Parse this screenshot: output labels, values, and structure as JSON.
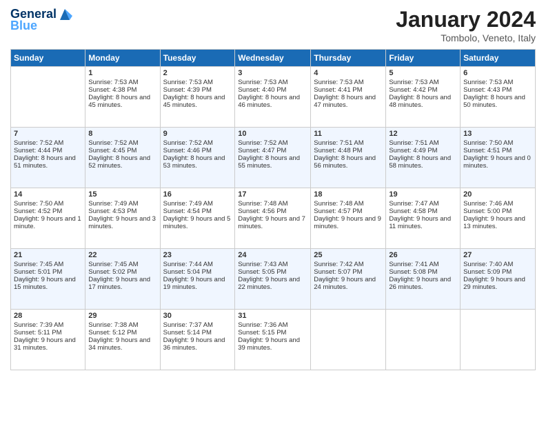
{
  "header": {
    "logo_general": "General",
    "logo_blue": "Blue",
    "title": "January 2024",
    "subtitle": "Tombolo, Veneto, Italy"
  },
  "weekdays": [
    "Sunday",
    "Monday",
    "Tuesday",
    "Wednesday",
    "Thursday",
    "Friday",
    "Saturday"
  ],
  "rows": [
    [
      {
        "day": "",
        "sunrise": "",
        "sunset": "",
        "daylight": "",
        "empty": true
      },
      {
        "day": "1",
        "sunrise": "Sunrise: 7:53 AM",
        "sunset": "Sunset: 4:38 PM",
        "daylight": "Daylight: 8 hours and 45 minutes."
      },
      {
        "day": "2",
        "sunrise": "Sunrise: 7:53 AM",
        "sunset": "Sunset: 4:39 PM",
        "daylight": "Daylight: 8 hours and 45 minutes."
      },
      {
        "day": "3",
        "sunrise": "Sunrise: 7:53 AM",
        "sunset": "Sunset: 4:40 PM",
        "daylight": "Daylight: 8 hours and 46 minutes."
      },
      {
        "day": "4",
        "sunrise": "Sunrise: 7:53 AM",
        "sunset": "Sunset: 4:41 PM",
        "daylight": "Daylight: 8 hours and 47 minutes."
      },
      {
        "day": "5",
        "sunrise": "Sunrise: 7:53 AM",
        "sunset": "Sunset: 4:42 PM",
        "daylight": "Daylight: 8 hours and 48 minutes."
      },
      {
        "day": "6",
        "sunrise": "Sunrise: 7:53 AM",
        "sunset": "Sunset: 4:43 PM",
        "daylight": "Daylight: 8 hours and 50 minutes."
      }
    ],
    [
      {
        "day": "7",
        "sunrise": "Sunrise: 7:52 AM",
        "sunset": "Sunset: 4:44 PM",
        "daylight": "Daylight: 8 hours and 51 minutes."
      },
      {
        "day": "8",
        "sunrise": "Sunrise: 7:52 AM",
        "sunset": "Sunset: 4:45 PM",
        "daylight": "Daylight: 8 hours and 52 minutes."
      },
      {
        "day": "9",
        "sunrise": "Sunrise: 7:52 AM",
        "sunset": "Sunset: 4:46 PM",
        "daylight": "Daylight: 8 hours and 53 minutes."
      },
      {
        "day": "10",
        "sunrise": "Sunrise: 7:52 AM",
        "sunset": "Sunset: 4:47 PM",
        "daylight": "Daylight: 8 hours and 55 minutes."
      },
      {
        "day": "11",
        "sunrise": "Sunrise: 7:51 AM",
        "sunset": "Sunset: 4:48 PM",
        "daylight": "Daylight: 8 hours and 56 minutes."
      },
      {
        "day": "12",
        "sunrise": "Sunrise: 7:51 AM",
        "sunset": "Sunset: 4:49 PM",
        "daylight": "Daylight: 8 hours and 58 minutes."
      },
      {
        "day": "13",
        "sunrise": "Sunrise: 7:50 AM",
        "sunset": "Sunset: 4:51 PM",
        "daylight": "Daylight: 9 hours and 0 minutes."
      }
    ],
    [
      {
        "day": "14",
        "sunrise": "Sunrise: 7:50 AM",
        "sunset": "Sunset: 4:52 PM",
        "daylight": "Daylight: 9 hours and 1 minute."
      },
      {
        "day": "15",
        "sunrise": "Sunrise: 7:49 AM",
        "sunset": "Sunset: 4:53 PM",
        "daylight": "Daylight: 9 hours and 3 minutes."
      },
      {
        "day": "16",
        "sunrise": "Sunrise: 7:49 AM",
        "sunset": "Sunset: 4:54 PM",
        "daylight": "Daylight: 9 hours and 5 minutes."
      },
      {
        "day": "17",
        "sunrise": "Sunrise: 7:48 AM",
        "sunset": "Sunset: 4:56 PM",
        "daylight": "Daylight: 9 hours and 7 minutes."
      },
      {
        "day": "18",
        "sunrise": "Sunrise: 7:48 AM",
        "sunset": "Sunset: 4:57 PM",
        "daylight": "Daylight: 9 hours and 9 minutes."
      },
      {
        "day": "19",
        "sunrise": "Sunrise: 7:47 AM",
        "sunset": "Sunset: 4:58 PM",
        "daylight": "Daylight: 9 hours and 11 minutes."
      },
      {
        "day": "20",
        "sunrise": "Sunrise: 7:46 AM",
        "sunset": "Sunset: 5:00 PM",
        "daylight": "Daylight: 9 hours and 13 minutes."
      }
    ],
    [
      {
        "day": "21",
        "sunrise": "Sunrise: 7:45 AM",
        "sunset": "Sunset: 5:01 PM",
        "daylight": "Daylight: 9 hours and 15 minutes."
      },
      {
        "day": "22",
        "sunrise": "Sunrise: 7:45 AM",
        "sunset": "Sunset: 5:02 PM",
        "daylight": "Daylight: 9 hours and 17 minutes."
      },
      {
        "day": "23",
        "sunrise": "Sunrise: 7:44 AM",
        "sunset": "Sunset: 5:04 PM",
        "daylight": "Daylight: 9 hours and 19 minutes."
      },
      {
        "day": "24",
        "sunrise": "Sunrise: 7:43 AM",
        "sunset": "Sunset: 5:05 PM",
        "daylight": "Daylight: 9 hours and 22 minutes."
      },
      {
        "day": "25",
        "sunrise": "Sunrise: 7:42 AM",
        "sunset": "Sunset: 5:07 PM",
        "daylight": "Daylight: 9 hours and 24 minutes."
      },
      {
        "day": "26",
        "sunrise": "Sunrise: 7:41 AM",
        "sunset": "Sunset: 5:08 PM",
        "daylight": "Daylight: 9 hours and 26 minutes."
      },
      {
        "day": "27",
        "sunrise": "Sunrise: 7:40 AM",
        "sunset": "Sunset: 5:09 PM",
        "daylight": "Daylight: 9 hours and 29 minutes."
      }
    ],
    [
      {
        "day": "28",
        "sunrise": "Sunrise: 7:39 AM",
        "sunset": "Sunset: 5:11 PM",
        "daylight": "Daylight: 9 hours and 31 minutes."
      },
      {
        "day": "29",
        "sunrise": "Sunrise: 7:38 AM",
        "sunset": "Sunset: 5:12 PM",
        "daylight": "Daylight: 9 hours and 34 minutes."
      },
      {
        "day": "30",
        "sunrise": "Sunrise: 7:37 AM",
        "sunset": "Sunset: 5:14 PM",
        "daylight": "Daylight: 9 hours and 36 minutes."
      },
      {
        "day": "31",
        "sunrise": "Sunrise: 7:36 AM",
        "sunset": "Sunset: 5:15 PM",
        "daylight": "Daylight: 9 hours and 39 minutes."
      },
      {
        "day": "",
        "sunrise": "",
        "sunset": "",
        "daylight": "",
        "empty": true
      },
      {
        "day": "",
        "sunrise": "",
        "sunset": "",
        "daylight": "",
        "empty": true
      },
      {
        "day": "",
        "sunrise": "",
        "sunset": "",
        "daylight": "",
        "empty": true
      }
    ]
  ]
}
